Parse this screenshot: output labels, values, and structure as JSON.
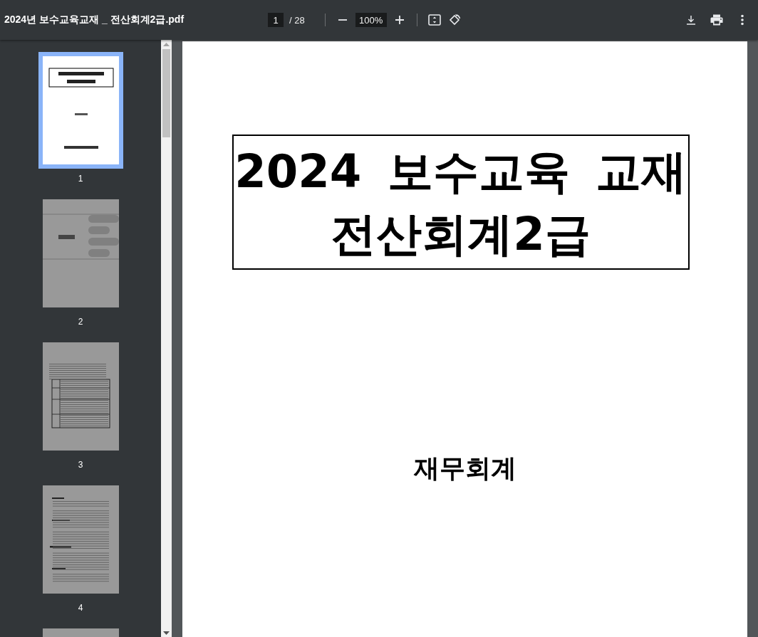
{
  "toolbar": {
    "title": "2024년 보수교육교재 _ 전산회계2급.pdf",
    "page_input": "1",
    "page_total": "/ 28",
    "zoom": "100%"
  },
  "thumbnails": [
    {
      "label": "1",
      "selected": true,
      "kind": "cover"
    },
    {
      "label": "2",
      "selected": false,
      "kind": "divider"
    },
    {
      "label": "3",
      "selected": false,
      "kind": "table"
    },
    {
      "label": "4",
      "selected": false,
      "kind": "text"
    },
    {
      "selected": false,
      "kind": "blank"
    }
  ],
  "page": {
    "title_lines": [
      "2024 보수교육 교재",
      "전산회계2급"
    ],
    "subtitle": "재무회계"
  }
}
